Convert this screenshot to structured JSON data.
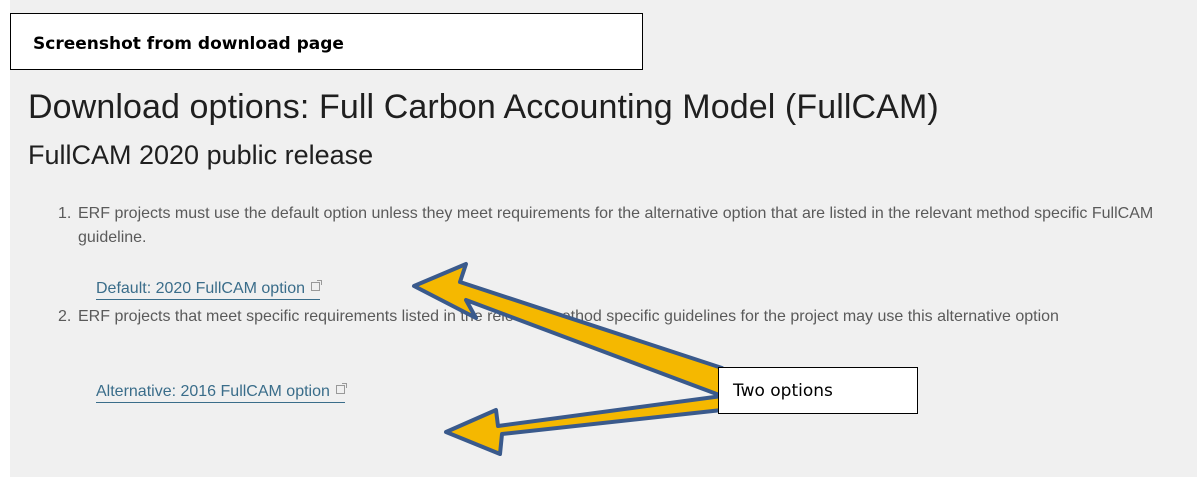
{
  "caption": "Screenshot from download page",
  "heading": "Download options: Full Carbon Accounting Model (FullCAM)",
  "subheading": "FullCAM 2020 public release",
  "items": [
    {
      "number": "1.",
      "text": "ERF projects must use the default option unless they meet requirements for the alternative option that are listed in the relevant method specific FullCAM guideline.",
      "link": "Default: 2020 FullCAM option"
    },
    {
      "number": "2.",
      "text": "ERF projects that meet specific requirements listed in the relevant method specific guidelines for the project may use this alternative option",
      "link": "Alternative: 2016 FullCAM option"
    }
  ],
  "annotation": "Two options",
  "colors": {
    "arrow_fill": "#f5b800",
    "arrow_stroke": "#3a5a8c",
    "link": "#3a6d8a"
  },
  "icons": [
    "external-link-icon"
  ]
}
